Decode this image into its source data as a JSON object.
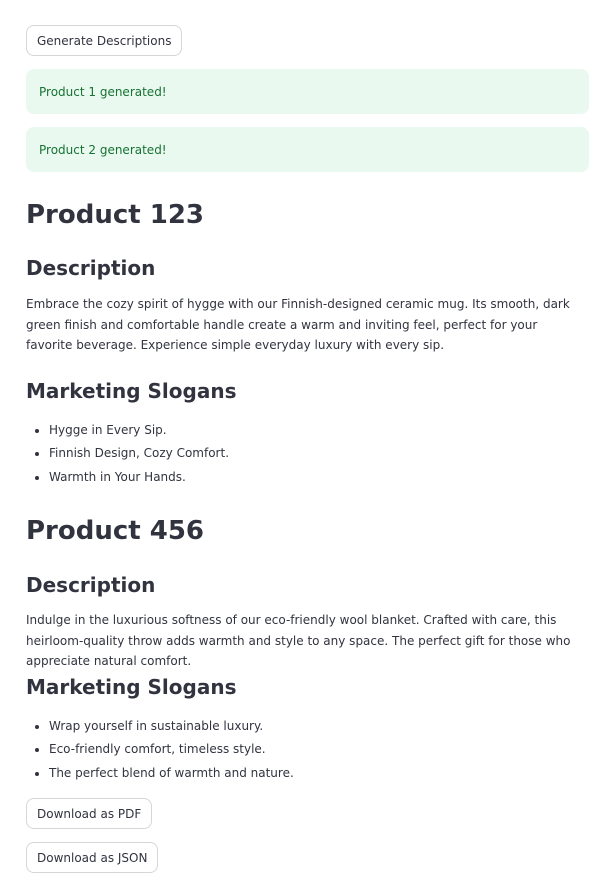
{
  "actions": {
    "generate_label": "Generate Descriptions",
    "download_pdf_label": "Download as PDF",
    "download_json_label": "Download as JSON"
  },
  "alerts": [
    {
      "text": "Product 1 generated!"
    },
    {
      "text": "Product 2 generated!"
    }
  ],
  "products": [
    {
      "title": "Product 123",
      "description_heading": "Description",
      "description": "Embrace the cozy spirit of hygge with our Finnish-designed ceramic mug. Its smooth, dark green finish and comfortable handle create a warm and inviting feel, perfect for your favorite beverage. Experience simple everyday luxury with every sip.",
      "slogans_heading": "Marketing Slogans",
      "slogans": [
        "Hygge in Every Sip.",
        "Finnish Design, Cozy Comfort.",
        "Warmth in Your Hands."
      ]
    },
    {
      "title": "Product 456",
      "description_heading": "Description",
      "description": "Indulge in the luxurious softness of our eco-friendly wool blanket. Crafted with care, this heirloom-quality throw adds warmth and style to any space. The perfect gift for those who appreciate natural comfort.",
      "slogans_heading": "Marketing Slogans",
      "slogans": [
        "Wrap yourself in sustainable luxury.",
        "Eco-friendly comfort, timeless style.",
        "The perfect blend of warmth and nature."
      ]
    }
  ],
  "colors": {
    "text": "#31333f",
    "success_bg": "#e9f9ef",
    "success_text": "#177233",
    "button_border": "#d5d6da"
  }
}
